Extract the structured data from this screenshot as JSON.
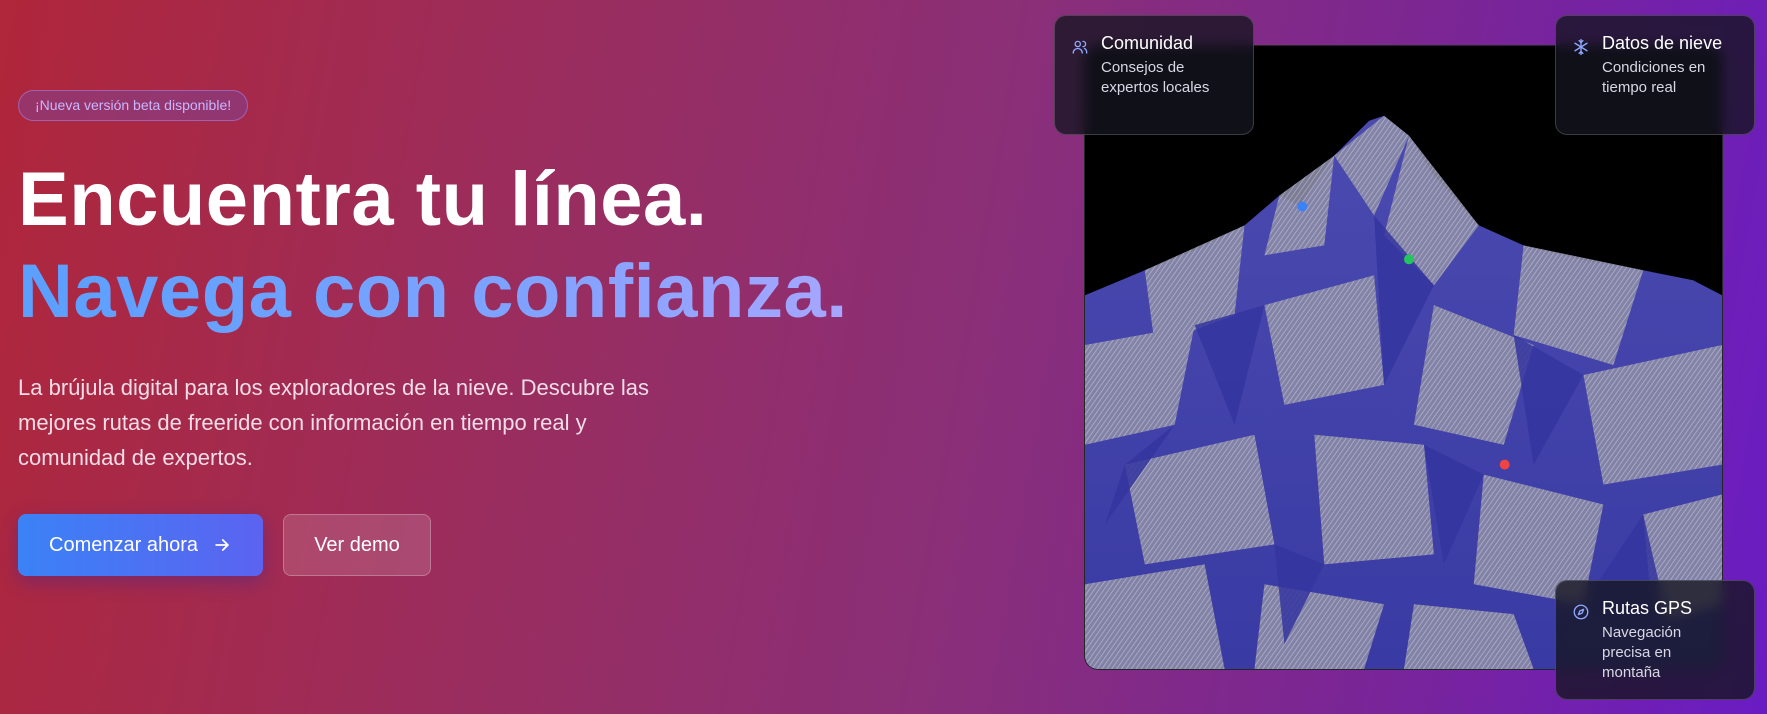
{
  "hero": {
    "badge": "¡Nueva versión beta disponible!",
    "headline_1": "Encuentra tu línea.",
    "headline_2": "Navega con confianza.",
    "description": "La brújula digital para los exploradores de la nieve. Descubre las mejores rutas de freeride con información en tiempo real y comunidad de expertos.",
    "primary_button": "Comenzar ahora",
    "secondary_button": "Ver demo"
  },
  "cards": {
    "community": {
      "title": "Comunidad",
      "subtitle": "Consejos de expertos locales",
      "icon": "users-icon"
    },
    "snow": {
      "title": "Datos de nieve",
      "subtitle": "Condiciones en tiempo real",
      "icon": "snowflake-icon"
    },
    "gps": {
      "title": "Rutas GPS",
      "subtitle": "Navegación precisa en montaña",
      "icon": "compass-icon"
    }
  },
  "scene": {
    "markers": [
      {
        "color": "#3b82f6"
      },
      {
        "color": "#22c55e"
      },
      {
        "color": "#ef4444"
      }
    ]
  },
  "colors": {
    "accent_blue": "#3b82f6",
    "accent_purple": "#5b63f0"
  }
}
